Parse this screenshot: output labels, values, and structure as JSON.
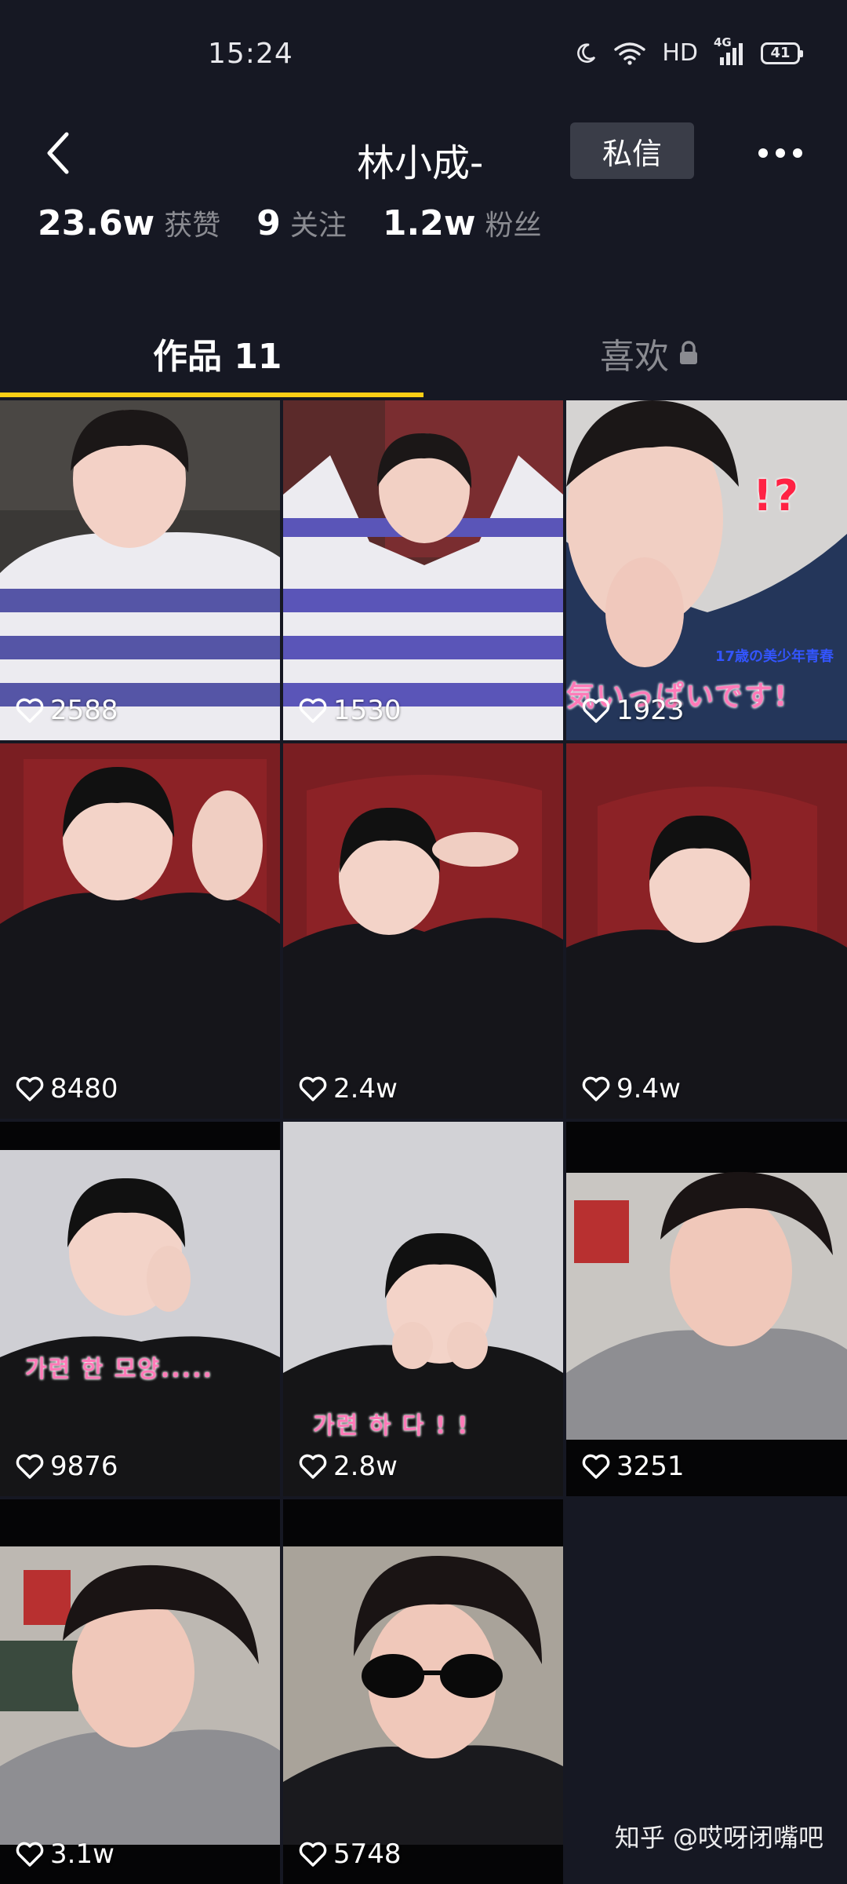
{
  "status_bar": {
    "time": "15:24",
    "network_label": "HD",
    "signal_label": "4G",
    "battery_level": "41"
  },
  "header": {
    "title": "林小成-",
    "dm_button": "私信"
  },
  "stats": [
    {
      "value": "23.6w",
      "label": "获赞"
    },
    {
      "value": "9",
      "label": "关注"
    },
    {
      "value": "1.2w",
      "label": "粉丝"
    }
  ],
  "tabs": {
    "works": "作品 11",
    "likes": "喜欢"
  },
  "videos": [
    {
      "likes": "2588"
    },
    {
      "likes": "1530"
    },
    {
      "likes": "1923",
      "caption": "気いっぱいです!",
      "marks": "!?",
      "small_caption": "17歳の美少年青春"
    },
    {
      "likes": "8480"
    },
    {
      "likes": "2.4w"
    },
    {
      "likes": "9.4w"
    },
    {
      "likes": "9876",
      "caption": "가련 한 모양....."
    },
    {
      "likes": "2.8w",
      "caption": "가련 하 다 ! !"
    },
    {
      "likes": "3251"
    },
    {
      "likes": "3.1w"
    },
    {
      "likes": "5748"
    }
  ],
  "watermark": "知乎 @哎呀闭嘴吧",
  "colors": {
    "background": "#161823",
    "tab_indicator": "#face15",
    "muted_text": "#8a8b91",
    "dm_button_bg": "#3a3d48"
  },
  "icons": {
    "back": "chevron-left-icon",
    "more": "more-dots-icon",
    "like": "heart-outline-icon",
    "lock": "lock-icon"
  }
}
